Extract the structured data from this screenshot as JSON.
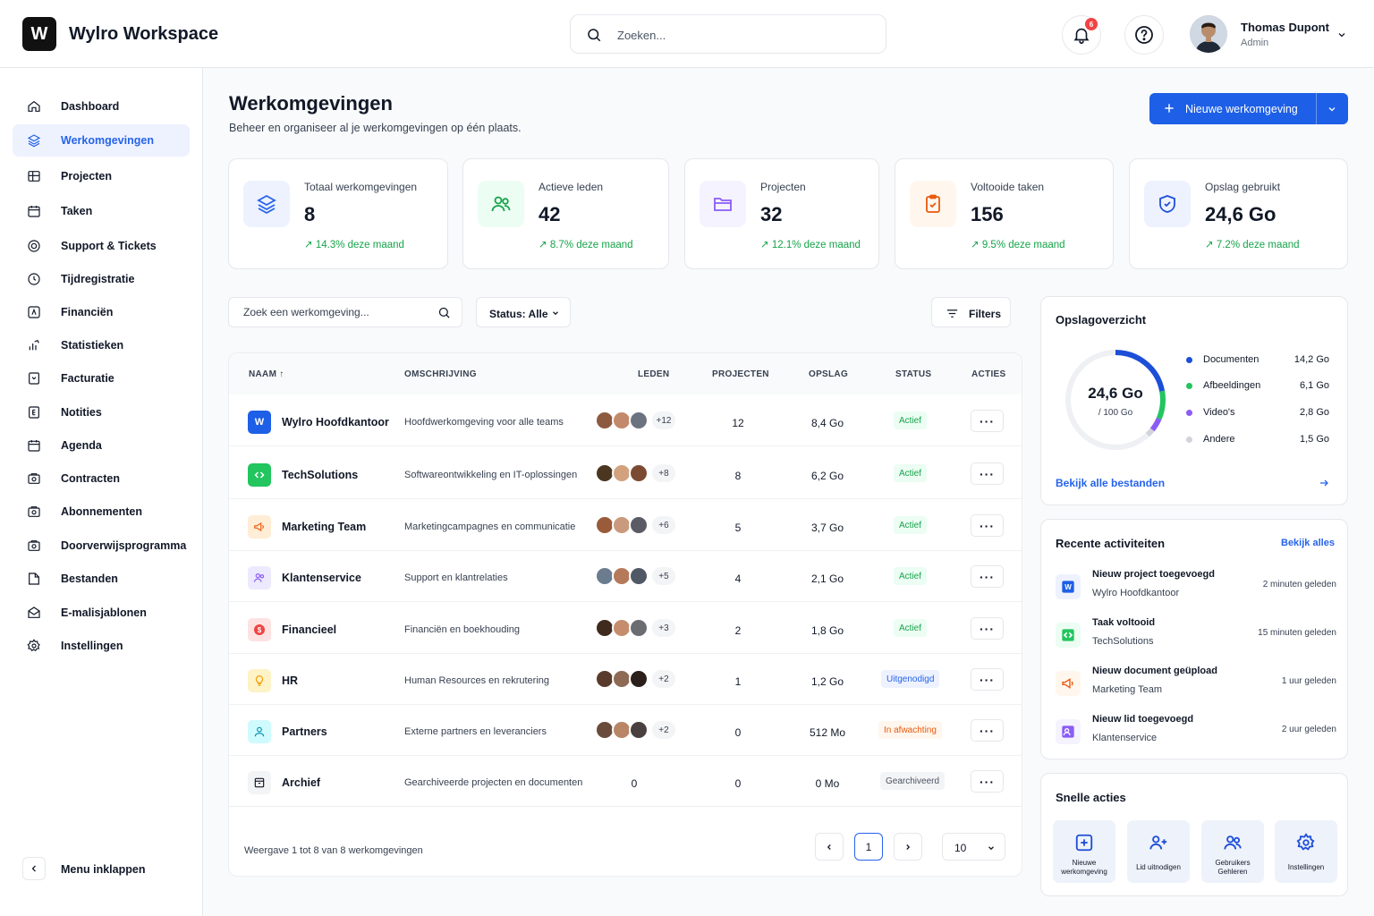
{
  "header": {
    "logo_letter": "W",
    "app_title": "Wylro Workspace",
    "search_placeholder": "Zoeken...",
    "notification_count": "6",
    "user": {
      "name": "Thomas Dupont",
      "role": "Admin"
    }
  },
  "sidebar": {
    "items": [
      {
        "label": "Dashboard",
        "icon": "home-icon"
      },
      {
        "label": "Werkomgevingen",
        "icon": "layers-icon",
        "active": true
      },
      {
        "label": "Projecten",
        "icon": "grid-icon"
      },
      {
        "label": "Taken",
        "icon": "calendar-check-icon"
      },
      {
        "label": "Support & Tickets",
        "icon": "lifebuoy-icon"
      },
      {
        "label": "Tijdregistratie",
        "icon": "clock-icon"
      },
      {
        "label": "Financiën",
        "icon": "finance-icon"
      },
      {
        "label": "Statistieken",
        "icon": "chart-icon"
      },
      {
        "label": "Facturatie",
        "icon": "invoice-icon"
      },
      {
        "label": "Notities",
        "icon": "notes-icon"
      },
      {
        "label": "Agenda",
        "icon": "calendar-icon"
      },
      {
        "label": "Contracten",
        "icon": "contract-icon"
      },
      {
        "label": "Abonnementen",
        "icon": "subscription-icon"
      },
      {
        "label": "Doorverwijsprogramma",
        "icon": "referral-icon"
      },
      {
        "label": "Bestanden",
        "icon": "files-icon"
      },
      {
        "label": "E-malisjablonen",
        "icon": "mail-icon"
      },
      {
        "label": "Instellingen",
        "icon": "gear-icon"
      }
    ],
    "collapse_label": "Menu inklappen"
  },
  "main": {
    "title": "Werkomgevingen",
    "subtitle": "Beheer en organiseer al je werkomgevingen op één plaats.",
    "new_button_label": "Nieuwe werkomgeving"
  },
  "stats": [
    {
      "label": "Totaal werkomgevingen",
      "value": "8",
      "trend": "↗ 14.3% deze maand"
    },
    {
      "label": "Actieve leden",
      "value": "42",
      "trend": "↗ 8.7% deze maand"
    },
    {
      "label": "Projecten",
      "value": "32",
      "trend": "↗ 12.1% deze maand"
    },
    {
      "label": "Voltooide taken",
      "value": "156",
      "trend": "↗ 9.5% deze maand"
    },
    {
      "label": "Opslag gebruikt",
      "value": "24,6 Go",
      "trend": "↗ 7.2% deze maand"
    }
  ],
  "table": {
    "search_placeholder": "Zoek een werkomgeving...",
    "status_filter": "Status: Alle",
    "filters_label": "Filters",
    "columns": [
      "NAAM ↑",
      "OMSCHRIJVING",
      "LEDEN",
      "PROJECTEN",
      "OPSLAG",
      "STATUS",
      "ACTIES"
    ],
    "rows": [
      {
        "icon": "W",
        "name": "Wylro Hoofdkantoor",
        "desc": "Hoofdwerkomgeving voor alle teams",
        "members_more": "+12",
        "projects": "12",
        "storage": "8,4 Go",
        "status": "Actief"
      },
      {
        "icon": "code-icon",
        "name": "TechSolutions",
        "desc": "Softwareontwikkeling en IT-oplossingen",
        "members_more": "+8",
        "projects": "8",
        "storage": "6,2 Go",
        "status": "Actief"
      },
      {
        "icon": "megaphone-icon",
        "name": "Marketing Team",
        "desc": "Marketingcampagnes en communicatie",
        "members_more": "+6",
        "projects": "5",
        "storage": "3,7 Go",
        "status": "Actief"
      },
      {
        "icon": "users-icon",
        "name": "Klantenservice",
        "desc": "Support en klantrelaties",
        "members_more": "+5",
        "projects": "4",
        "storage": "2,1 Go",
        "status": "Actief"
      },
      {
        "icon": "dollar-icon",
        "name": "Financieel",
        "desc": "Financiën en boekhouding",
        "members_more": "+3",
        "projects": "2",
        "storage": "1,8 Go",
        "status": "Actief"
      },
      {
        "icon": "lightbulb-icon",
        "name": "HR",
        "desc": "Human Resources en rekrutering",
        "members_more": "+2",
        "projects": "1",
        "storage": "1,2 Go",
        "status": "Uitgenodigd"
      },
      {
        "icon": "partners-icon",
        "name": "Partners",
        "desc": "Externe partners en leveranciers",
        "members_more": "+2",
        "projects": "0",
        "storage": "512 Mo",
        "status": "In afwachting"
      },
      {
        "icon": "archive-icon",
        "name": "Archief",
        "desc": "Gearchiveerde projecten en documenten",
        "members_count": "0",
        "projects": "0",
        "storage": "0 Mo",
        "status": "Gearchiveerd"
      }
    ],
    "footer_info": "Weergave 1 tot 8 van 8 werkomgevingen",
    "current_page": "1",
    "page_size": "10"
  },
  "storage": {
    "title": "Opslagoverzicht",
    "total": "24,6 Go",
    "capacity": "/ 100 Go",
    "used_fraction": 0.246,
    "legend": [
      {
        "name": "Documenten",
        "value": "14,2 Go",
        "color": "#1d4ed8"
      },
      {
        "name": "Afbeeldingen",
        "value": "6,1 Go",
        "color": "#22c55e"
      },
      {
        "name": "Video's",
        "value": "2,8 Go",
        "color": "#8b5cf6"
      },
      {
        "name": "Andere",
        "value": "1,5 Go",
        "color": "#d1d5db"
      }
    ],
    "link": "Bekijk alle bestanden"
  },
  "activities": {
    "title": "Recente activiteiten",
    "view_all": "Bekijk alles",
    "items": [
      {
        "title": "Nieuw project toegevoegd",
        "sub": "Wylro Hoofdkantoor",
        "time": "2 minuten geleden"
      },
      {
        "title": "Taak voltooid",
        "sub": "TechSolutions",
        "time": "15 minuten geleden"
      },
      {
        "title": "Nieuw document geüpload",
        "sub": "Marketing Team",
        "time": "1 uur geleden"
      },
      {
        "title": "Nieuw lid toegevoegd",
        "sub": "Klantenservice",
        "time": "2 uur geleden"
      }
    ]
  },
  "quick_actions": {
    "title": "Snelle acties",
    "items": [
      {
        "label": "Nieuwe werkomgeving"
      },
      {
        "label": "Lid uitnodigen"
      },
      {
        "label": "Gebruikers Gehleren"
      },
      {
        "label": "Instellingen"
      }
    ]
  }
}
